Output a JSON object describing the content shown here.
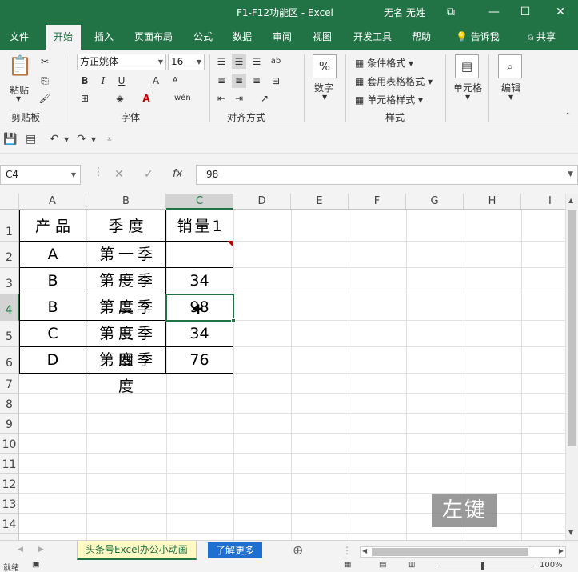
{
  "window": {
    "title": "F1-F12功能区  -  Excel",
    "user": "无名 无姓",
    "controls": [
      "⧉",
      "—",
      "☐",
      "✕"
    ]
  },
  "tabs": [
    "文件",
    "开始",
    "插入",
    "页面布局",
    "公式",
    "数据",
    "审阅",
    "视图",
    "开发工具",
    "帮助",
    "告诉我",
    "共享"
  ],
  "ribbon": {
    "clipboard": {
      "paste": "粘贴",
      "label": "剪贴板"
    },
    "font": {
      "name": "方正姚体",
      "size": "16",
      "label": "字体"
    },
    "alignment": {
      "label": "对齐方式"
    },
    "number": {
      "button": "数字",
      "symbol": "%"
    },
    "styles": {
      "conditional": "条件格式",
      "table": "套用表格格式",
      "cell": "单元格样式",
      "label": "样式"
    },
    "cells": {
      "button": "单元格"
    },
    "editing": {
      "button": "编辑"
    }
  },
  "formula_bar": {
    "name_box": "C4",
    "fx": "fx",
    "value": "98"
  },
  "grid": {
    "columns": [
      "A",
      "B",
      "C",
      "D",
      "E",
      "F",
      "G",
      "H",
      "I"
    ],
    "selected_column": "C",
    "rows": [
      "1",
      "2",
      "3",
      "4",
      "5",
      "6",
      "7",
      "8",
      "9",
      "10",
      "11",
      "12",
      "13",
      "14"
    ],
    "selected_row": "4",
    "table": [
      [
        "产品",
        "季度",
        "销量1"
      ],
      [
        "A",
        "第一季度",
        ""
      ],
      [
        "B",
        "第一季度",
        "34"
      ],
      [
        "B",
        "第二季度",
        "98"
      ],
      [
        "C",
        "第三季度",
        "34"
      ],
      [
        "D",
        "第四季度",
        "76"
      ]
    ]
  },
  "sheets": {
    "active": "头条号Excel办公小动画",
    "link": "了解更多",
    "add": "⊕"
  },
  "status": {
    "ready": "就绪",
    "zoom": "100%"
  },
  "hint": "左键",
  "colors": {
    "brand": "#217346",
    "link_tab": "#1e6fcf",
    "active_sheet": "#fff9c4"
  }
}
